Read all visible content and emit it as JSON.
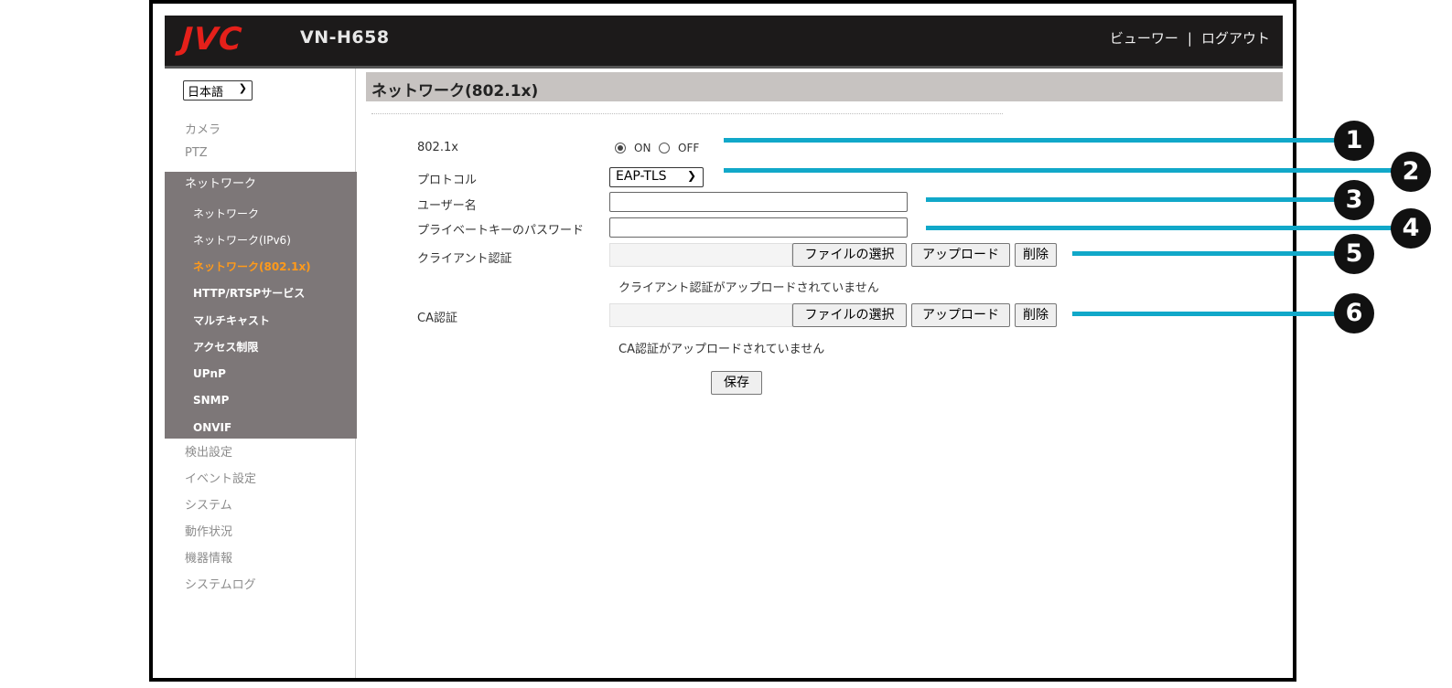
{
  "header": {
    "logo": "JVC",
    "model": "VN-H658",
    "viewer_link": "ビューワー",
    "separator": "|",
    "logout_link": "ログアウト"
  },
  "sidebar": {
    "language": "日本語",
    "items_top": [
      "カメラ",
      "PTZ"
    ],
    "network_header": "ネットワーク",
    "network_sub": [
      "ネットワーク",
      "ネットワーク(IPv6)",
      "ネットワーク(802.1x)",
      "HTTP/RTSPサービス",
      "マルチキャスト",
      "アクセス制限",
      "UPnP",
      "SNMP",
      "ONVIF"
    ],
    "active_sub_index": 2,
    "items_bottom": [
      "検出設定",
      "イベント設定",
      "システム",
      "動作状況",
      "機器情報",
      "システムログ"
    ]
  },
  "main": {
    "title": "ネットワーク(802.1x)",
    "fields": {
      "dot1x_label": "802.1x",
      "on_label": "ON",
      "off_label": "OFF",
      "dot1x_value": "ON",
      "protocol_label": "プロトコル",
      "protocol_value": "EAP-TLS",
      "username_label": "ユーザー名",
      "username_value": "",
      "private_key_password_label": "プライベートキーのパスワード",
      "private_key_password_value": "",
      "client_cert_label": "クライアント認証",
      "client_cert_status": "クライアント認証がアップロードされていません",
      "ca_cert_label": "CA認証",
      "ca_cert_status": "CA認証がアップロードされていません"
    },
    "buttons": {
      "choose_file": "ファイルの選択",
      "upload": "アップロード",
      "delete": "削除",
      "save": "保存"
    }
  },
  "callouts": [
    "1",
    "2",
    "3",
    "4",
    "5",
    "6"
  ],
  "colors": {
    "header_bg": "#1c1a1a",
    "logo_red": "#e5201a",
    "sidebar_active_bg": "#7d7778",
    "active_item": "#ff9a1a",
    "title_bar": "#c7c3c1",
    "callout_line": "#11a8c9"
  }
}
